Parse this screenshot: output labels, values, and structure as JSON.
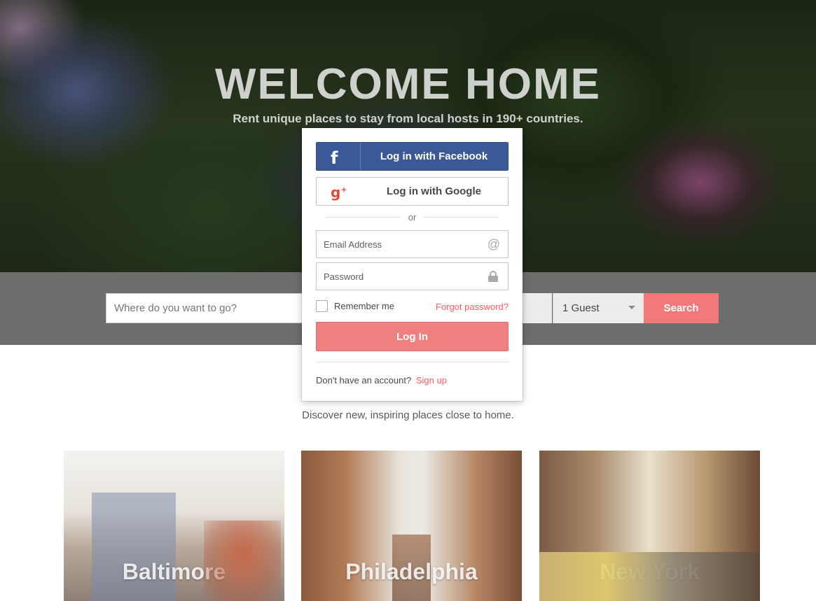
{
  "hero": {
    "title": "WELCOME HOME",
    "subtitle": "Rent unique places to stay from local hosts in 190+ countries."
  },
  "search": {
    "placeholder": "Where do you want to go?",
    "guests_value": "1 Guest",
    "search_label": "Search"
  },
  "discover": {
    "text": "Discover new, inspiring places close to home."
  },
  "cities": [
    {
      "name": "Baltimore"
    },
    {
      "name": "Philadelphia"
    },
    {
      "name": "New York"
    }
  ],
  "login_modal": {
    "facebook_label": "Log in with Facebook",
    "facebook_icon": "f",
    "google_label": "Log in with Google",
    "google_icon": "g",
    "or_text": "or",
    "email_placeholder": "Email Address",
    "password_placeholder": "Password",
    "remember_label": "Remember me",
    "forgot_label": "Forgot password?",
    "login_label": "Log In",
    "no_account_text": "Don't have an account?",
    "signup_label": "Sign up"
  },
  "colors": {
    "brand": "#ff5a5f",
    "login_button": "#f07f7f",
    "facebook": "#3b5998",
    "google_icon": "#dd4b39"
  }
}
